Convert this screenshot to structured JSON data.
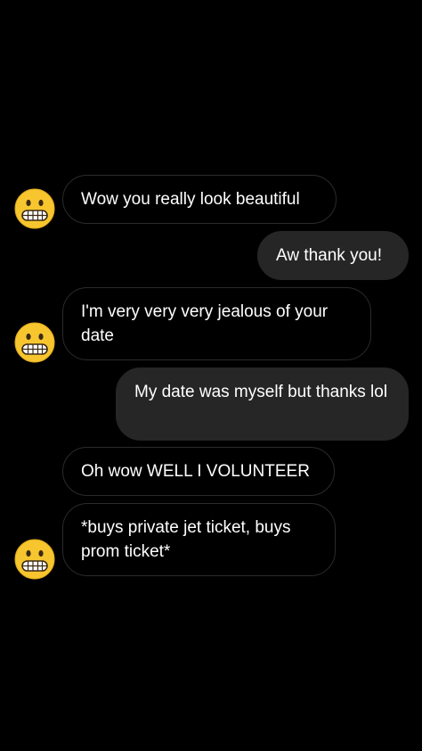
{
  "conversation": {
    "messages": [
      {
        "sender": "other",
        "text": "Wow you really look beautiful",
        "avatar": "grimacing-face-emoji"
      },
      {
        "sender": "me",
        "text": "Aw thank you!"
      },
      {
        "sender": "other",
        "text": "I'm very very very jealous of your date",
        "avatar": "grimacing-face-emoji"
      },
      {
        "sender": "me",
        "text": "My date was myself but thanks lol"
      },
      {
        "sender": "other",
        "text": "Oh wow WELL I VOLUNTEER"
      },
      {
        "sender": "other",
        "text": "*buys private jet ticket, buys prom ticket*",
        "avatar": "grimacing-face-emoji"
      }
    ]
  },
  "colors": {
    "background": "#000000",
    "incoming_bubble_border": "#2b2b2b",
    "outgoing_bubble": "#262626",
    "text": "#ffffff",
    "emoji_face": "#f7c62f"
  }
}
